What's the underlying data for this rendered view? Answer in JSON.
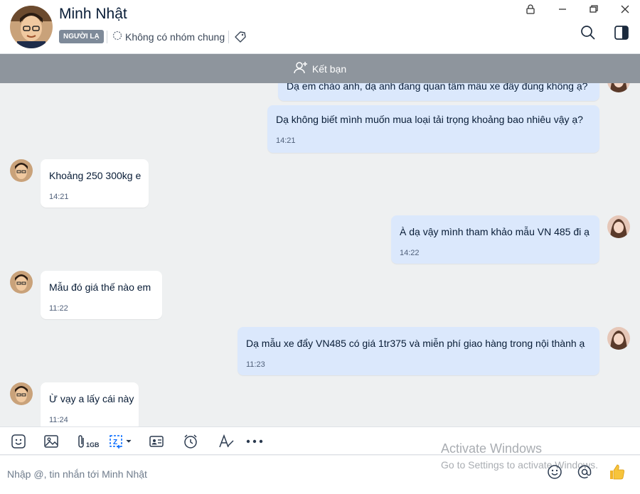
{
  "contact": {
    "name": "Minh Nhật",
    "badge": "NGƯỜI LẠ",
    "group_info": "Không có nhóm chung"
  },
  "friend_bar": {
    "label": "Kết bạn"
  },
  "messages": [
    {
      "dir": "out",
      "text": "Dạ em chào anh, dạ anh đang quan tâm mẫu xe đẩy đúng không ạ?",
      "time": ""
    },
    {
      "dir": "out",
      "text": "Dạ không biết mình muốn mua loại tải trọng khoảng bao nhiêu vậy ạ?",
      "time": "14:21"
    },
    {
      "dir": "in",
      "text": "Khoảng 250 300kg e",
      "time": "14:21"
    },
    {
      "dir": "out",
      "text": "À dạ vậy mình tham khảo mẫu VN 485 đi ạ",
      "time": "14:22"
    },
    {
      "dir": "in",
      "text": "Mẫu đó giá thế nào em",
      "time": "11:22"
    },
    {
      "dir": "out",
      "text": "Dạ mẫu xe đẩy VN485 có giá 1tr375 và miễn phí giao hàng trong nội thành ạ",
      "time": "11:23"
    },
    {
      "dir": "in",
      "text": "Ừ vạy a lấy cái này",
      "time": "11:24"
    }
  ],
  "toolbar": {
    "file_size_label": "1GB"
  },
  "input": {
    "placeholder": "Nhập @, tin nhắn tới Minh Nhật"
  },
  "watermark": {
    "line1": "Activate Windows",
    "line2": "Go to Settings to activate Windows."
  },
  "icons": {
    "window": [
      "lock-icon",
      "minimize-icon",
      "restore-icon",
      "close-icon"
    ],
    "header": [
      "search-icon",
      "sidebar-toggle-icon",
      "tag-icon"
    ],
    "toolbar": [
      "sticker-icon",
      "image-icon",
      "attachment-icon",
      "screenshot-icon",
      "contact-card-icon",
      "reminder-clock-icon",
      "text-format-icon",
      "more-icon"
    ],
    "input": [
      "emoji-icon",
      "mention-icon",
      "thumbs-up-icon"
    ]
  },
  "colors": {
    "accent": "#0068ff",
    "outgoing_bubble": "#dbe8fc",
    "incoming_bubble": "#ffffff",
    "friend_bar": "#8e959d",
    "badge": "#7e8a99"
  }
}
